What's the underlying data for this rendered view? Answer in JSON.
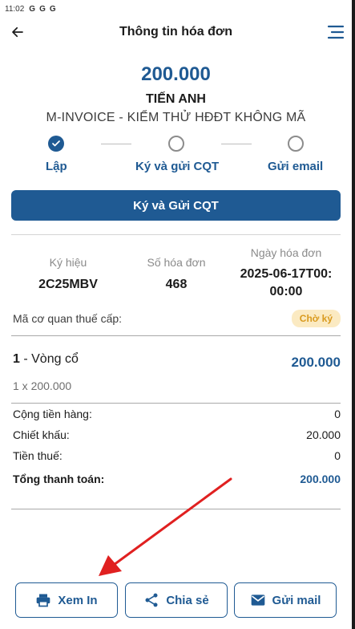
{
  "status_bar": {
    "time": "11:02",
    "icons": [
      "G",
      "G",
      "G"
    ]
  },
  "header": {
    "title": "Thông tin hóa đơn",
    "back_icon": "arrow-left-icon",
    "menu_icon": "menu-icon"
  },
  "invoice": {
    "amount": "200.000",
    "customer": "TIẾN ANH",
    "company": "M-INVOICE - KIỂM THỬ HĐĐT KHÔNG MÃ"
  },
  "steps": [
    {
      "label": "Lập",
      "state": "done"
    },
    {
      "label": "Ký và gửi CQT",
      "state": "todo"
    },
    {
      "label": "Gửi email",
      "state": "todo"
    }
  ],
  "primary_action": {
    "label": "Ký và Gửi CQT"
  },
  "info": {
    "symbol_label": "Ký hiệu",
    "symbol_value": "2C25MBV",
    "number_label": "Số hóa đơn",
    "number_value": "468",
    "date_label": "Ngày hóa đơn",
    "date_line1": "2025-06-17T00:",
    "date_line2": "00:00"
  },
  "tax": {
    "label": "Mã cơ quan thuế cấp:",
    "status": "Chờ ký"
  },
  "item": {
    "index": "1",
    "name": " - Vòng cổ",
    "total": "200.000",
    "qty_line": "1 x 200.000"
  },
  "summary": [
    {
      "label": "Cộng tiền hàng:",
      "value": "0"
    },
    {
      "label": "Chiết khấu:",
      "value": "20.000"
    },
    {
      "label": "Tiền thuế:",
      "value": "0"
    },
    {
      "label": "Tổng thanh toán:",
      "value": "200.000"
    }
  ],
  "bottom_actions": {
    "view_label": "Xem In",
    "share_label": "Chia sẻ",
    "mail_label": "Gửi mail"
  },
  "colors": {
    "brand": "#1f5a93",
    "badge_bg": "#fbeac2",
    "badge_text": "#d99a1e",
    "annotation_arrow": "#e02020"
  }
}
